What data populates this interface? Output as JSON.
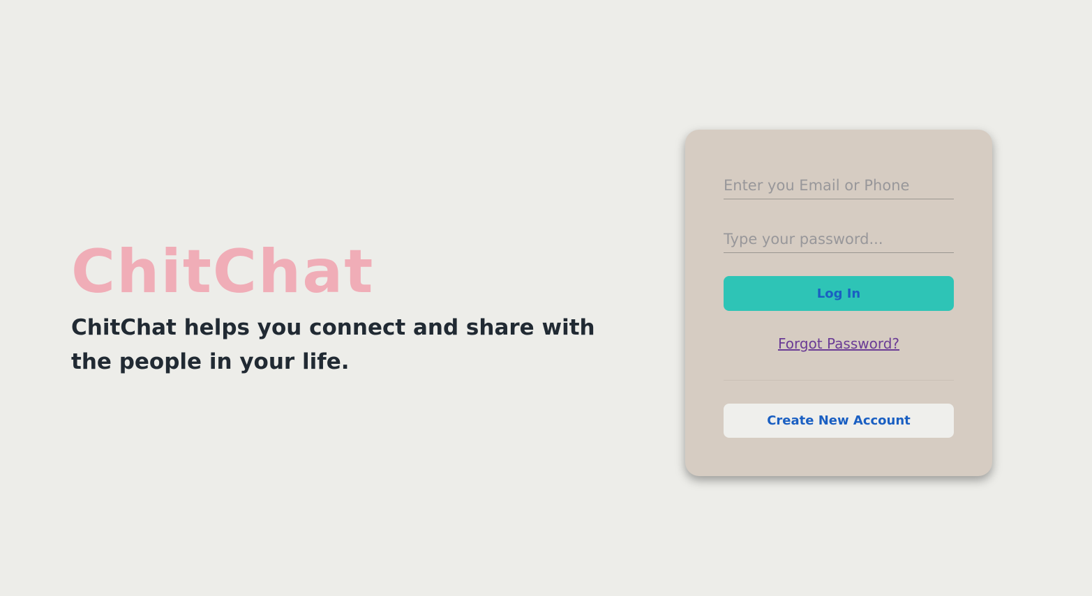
{
  "brand": {
    "title": "ChitChat",
    "tagline": "ChitChat helps you connect and share with the people in your life."
  },
  "login": {
    "email_placeholder": "Enter you Email or Phone",
    "password_placeholder": "Type your password...",
    "login_label": "Log In",
    "forgot_label": "Forgot Password?",
    "create_label": "Create New Account"
  },
  "colors": {
    "background": "#edede9",
    "brand_pink": "#f0adb7",
    "card": "#d6ccc2",
    "login_button": "#2ec4b6",
    "button_text": "#1a5fc2",
    "link": "#6a3b95"
  }
}
